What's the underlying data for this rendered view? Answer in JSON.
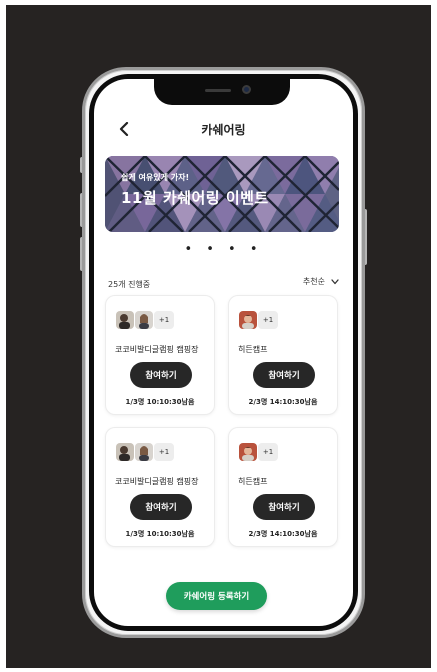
{
  "header": {
    "title": "카쉐어링"
  },
  "banner": {
    "subtitle": "쉽게 여유있게 가자!",
    "title": "11월 카쉐어링 이벤트"
  },
  "pagination": {
    "dots": "• • • •"
  },
  "list": {
    "count_label": "25개 진행중",
    "sort_label": "추천순"
  },
  "cards": [
    {
      "name": "코코비발디글램핑 캠핑장",
      "extra": "+1",
      "button": "참여하기",
      "info": "1/3명 10:10:30남음"
    },
    {
      "name": "히든캠프",
      "extra": "+1",
      "button": "참여하기",
      "info": "2/3명 14:10:30남음"
    },
    {
      "name": "코코비발디글램핑 캠핑장",
      "extra": "+1",
      "button": "참여하기",
      "info": "1/3명 10:10:30남음"
    },
    {
      "name": "히든캠프",
      "extra": "+1",
      "button": "참여하기",
      "info": "2/3명 14:10:30남음"
    }
  ],
  "footer": {
    "register_label": "카쉐어링 등록하기"
  },
  "colors": {
    "accent": "#1f9d5c",
    "button_dark": "#272727",
    "background": "#262322"
  }
}
